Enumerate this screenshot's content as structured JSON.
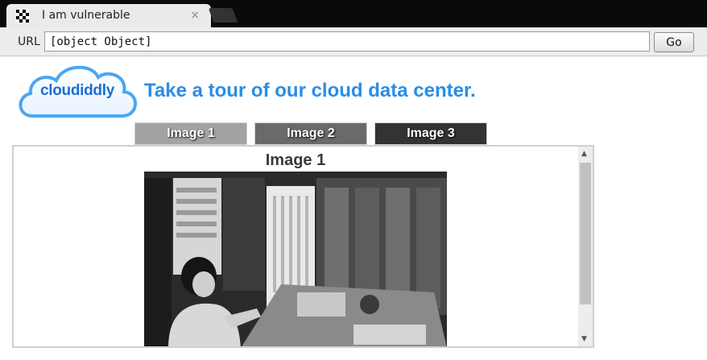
{
  "browser": {
    "tab_title": "I am vulnerable",
    "tab_close": "×",
    "url_label": "URL",
    "url_value": "[object Object]",
    "go_label": "Go"
  },
  "site": {
    "logo_text": "cloudiddly",
    "headline": "Take a tour of our cloud data center."
  },
  "tabs": [
    {
      "label": "Image 1"
    },
    {
      "label": "Image 2"
    },
    {
      "label": "Image 3"
    }
  ],
  "content": {
    "title": "Image 1"
  },
  "scrollbar": {
    "up_arrow": "▲",
    "down_arrow": "▼"
  },
  "colors": {
    "headline": "#2a8de6",
    "tab1": "#a3a3a3",
    "tab2": "#6a6a6a",
    "tab3": "#333333"
  }
}
